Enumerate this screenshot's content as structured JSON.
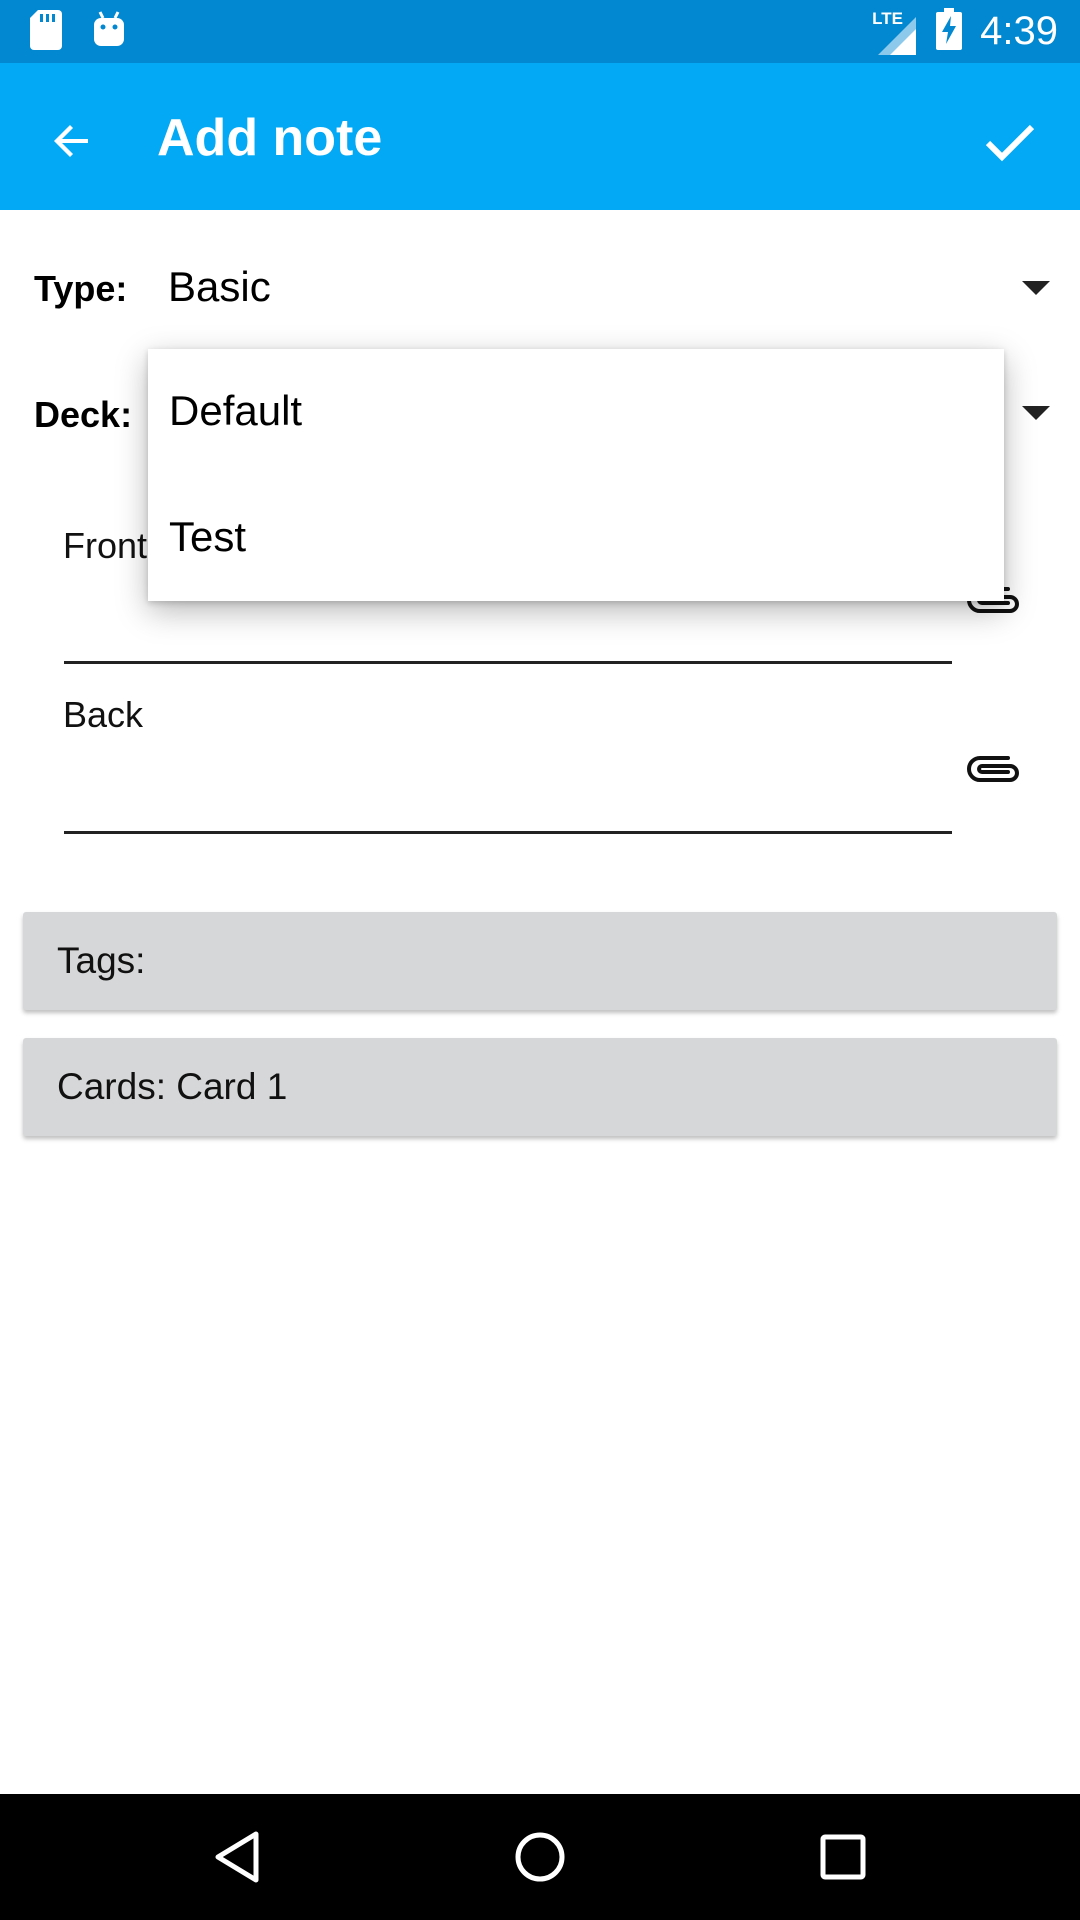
{
  "status_bar": {
    "time": "4:39",
    "network": "LTE",
    "icons": [
      "sd-card-icon",
      "android-debug-icon",
      "signal-icon",
      "battery-charging-icon"
    ]
  },
  "app_bar": {
    "title": "Add note",
    "back_icon": "arrow-left-icon",
    "confirm_icon": "check-icon",
    "background": "#03a9f4"
  },
  "form": {
    "type_label": "Type:",
    "type_value": "Basic",
    "deck_label": "Deck:",
    "fields": [
      {
        "label": "Front",
        "value": ""
      },
      {
        "label": "Back",
        "value": ""
      }
    ],
    "tags_label": "Tags:",
    "cards_label": "Cards: Card 1"
  },
  "deck_dropdown": {
    "options": [
      "Default",
      "Test"
    ]
  },
  "nav_bar": {
    "buttons": [
      "back-triangle-icon",
      "home-circle-icon",
      "recents-square-icon"
    ]
  },
  "colors": {
    "status_bar": "#0288d1",
    "app_bar": "#03a9f4",
    "button_bar": "#d6d7d8"
  }
}
